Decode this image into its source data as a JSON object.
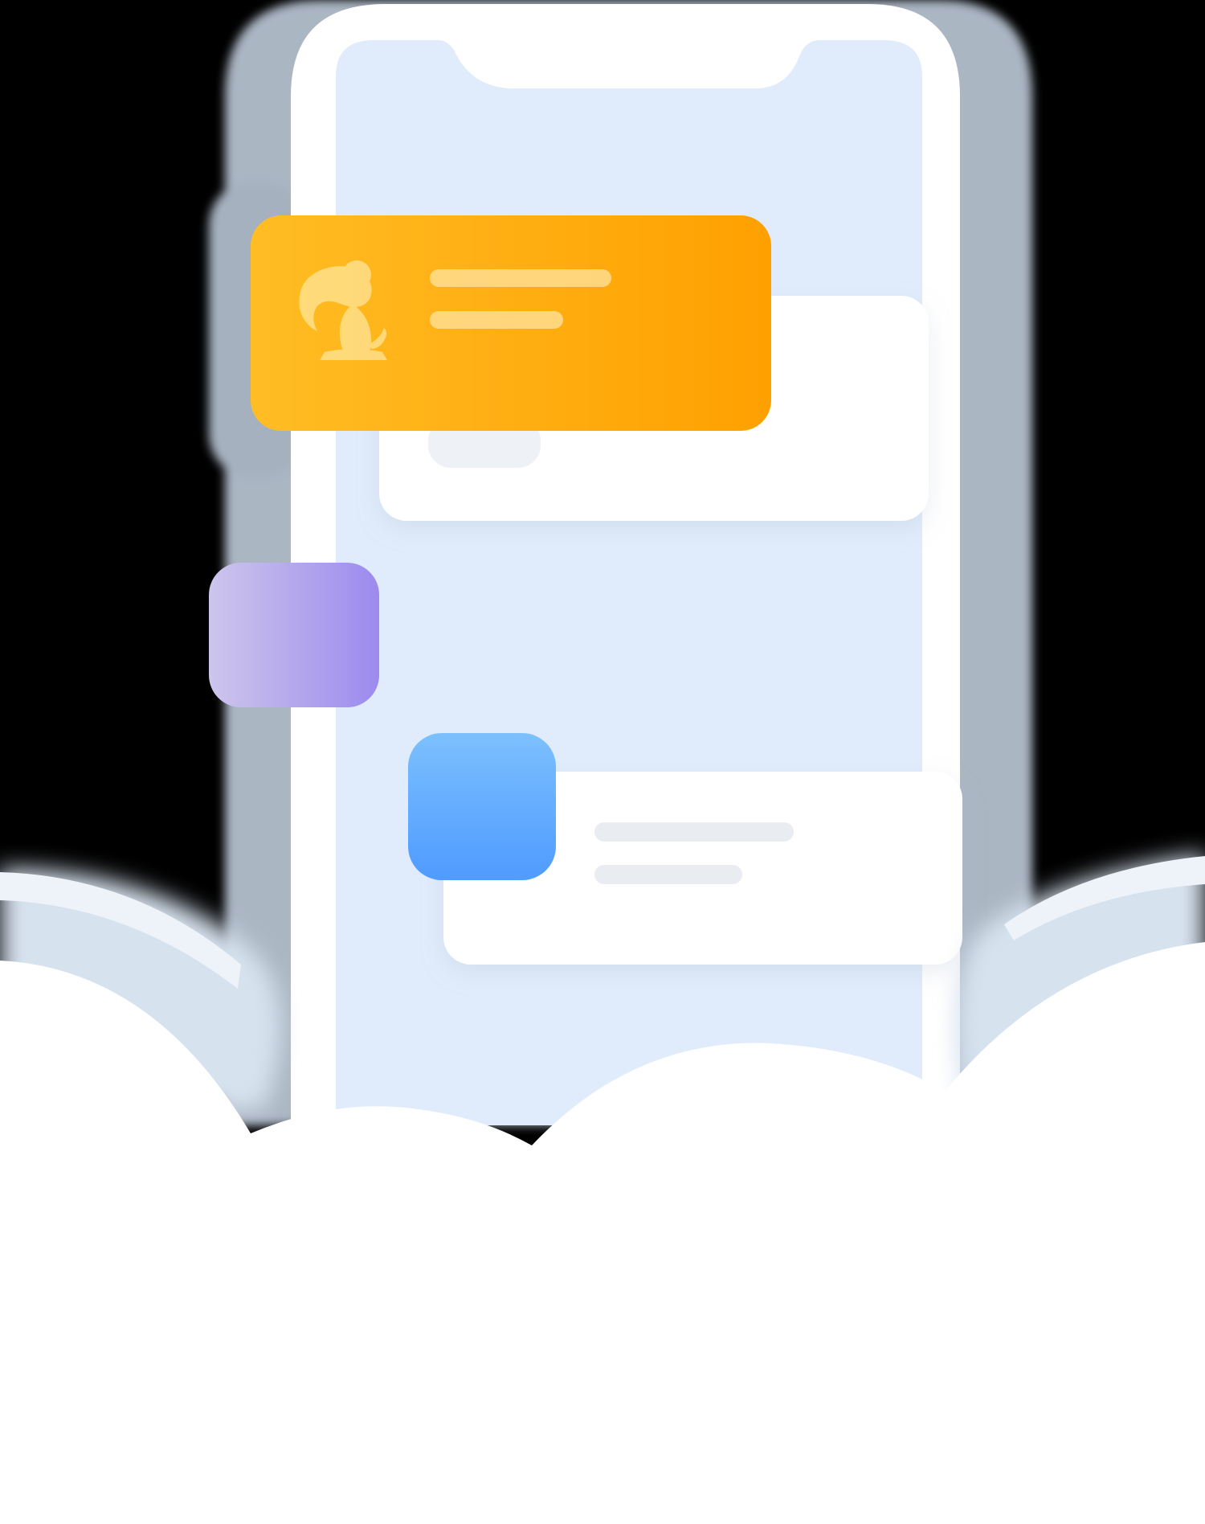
{
  "illustration": {
    "colors": {
      "background": "#000000",
      "phone_frame": "#ffffff",
      "phone_screen": "#e0ecfb",
      "cloud": "#ffffff",
      "placeholder_bar": "#e9edf2",
      "orange_start": "#ffbd24",
      "orange_end": "#ffa000",
      "purple_start": "#cdc6ec",
      "purple_end": "#9c8aee",
      "blue_start": "#7cc0fd",
      "blue_end": "#4f9bff"
    },
    "icons": {
      "notification_icon": "bird-mascot-icon"
    }
  }
}
